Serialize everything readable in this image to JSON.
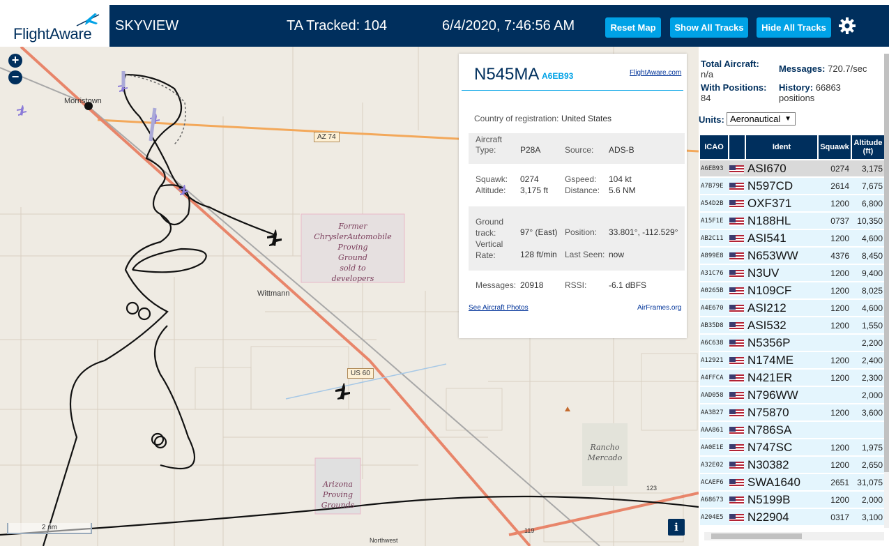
{
  "header": {
    "logo": "FlightAware",
    "app_title": "SKYVIEW",
    "ta_tracked": "TA Tracked: 104",
    "datetime": "6/4/2020, 7:46:56 AM",
    "buttons": {
      "reset": "Reset Map",
      "show_all": "Show All Tracks",
      "hide_all": "Hide All Tracks"
    },
    "settings_icon": "gear-icon"
  },
  "map": {
    "zoom_in": "+",
    "zoom_out": "−",
    "scale": "2 nm",
    "places": {
      "morristown": "Morristown",
      "wittmann": "Wittmann"
    },
    "shields": {
      "az74": "AZ 74",
      "us60": "US 60",
      "r123": "123",
      "r119": "119"
    },
    "chrysler": [
      "Former",
      "ChryslerAutomobile",
      "Proving",
      "Ground",
      "sold to",
      "developers"
    ],
    "arizona": [
      "Arizona",
      "Proving",
      "Grounds"
    ],
    "rancho": [
      "Rancho",
      "Mercado"
    ],
    "northwest": "Northwest",
    "info": "i"
  },
  "selected": {
    "callsign": "N545MA",
    "icao": "A6EB93",
    "fa_link": "FlightAware.com",
    "country_label": "Country of registration:",
    "country": "United States",
    "type_label": "Aircraft Type:",
    "type": "P28A",
    "source_label": "Source:",
    "source": "ADS-B",
    "squawk_label": "Squawk:",
    "squawk": "0274",
    "gspeed_label": "Gspeed:",
    "gspeed": "104 kt",
    "altitude_label": "Altitude:",
    "altitude": "3,175 ft",
    "distance_label": "Distance:",
    "distance": "5.6 NM",
    "track_label": "Ground track:",
    "track": "97° (East)",
    "position_label": "Position:",
    "position": "33.801°, -112.529°",
    "vrate_label": "Vertical Rate:",
    "vrate": "128 ft/min",
    "lastseen_label": "Last Seen:",
    "lastseen": "now",
    "messages_label": "Messages:",
    "messages": "20918",
    "rssi_label": "RSSI:",
    "rssi": "-6.1 dBFS",
    "photos_link": "See Aircraft Photos",
    "airframes_link": "AirFrames.org"
  },
  "sidebar": {
    "total_label": "Total Aircraft:",
    "total": "n/a",
    "messages_label": "Messages:",
    "messages": "720.7/sec",
    "withpos_label": "With Positions:",
    "withpos": "84",
    "history_label": "History:",
    "history": "66863 positions",
    "units_label": "Units:",
    "units": "Aeronautical",
    "columns": [
      "ICAO",
      "",
      "Ident",
      "Squawk",
      "Altitude (ft)"
    ],
    "rows": [
      {
        "icao": "A6EB93",
        "ident": "ASI670",
        "squawk": "0274",
        "alt": "3,175",
        "sel": true
      },
      {
        "icao": "A7B79E",
        "ident": "N597CD",
        "squawk": "2614",
        "alt": "7,675"
      },
      {
        "icao": "A54D2B",
        "ident": "OXF371",
        "squawk": "1200",
        "alt": "6,800"
      },
      {
        "icao": "A15F1E",
        "ident": "N188HL",
        "squawk": "0737",
        "alt": "10,350"
      },
      {
        "icao": "AB2C11",
        "ident": "ASI541",
        "squawk": "1200",
        "alt": "4,600"
      },
      {
        "icao": "A899E8",
        "ident": "N653WW",
        "squawk": "4376",
        "alt": "8,450"
      },
      {
        "icao": "A31C76",
        "ident": "N3UV",
        "squawk": "1200",
        "alt": "9,400"
      },
      {
        "icao": "A0265B",
        "ident": "N109CF",
        "squawk": "1200",
        "alt": "8,025"
      },
      {
        "icao": "A4E670",
        "ident": "ASI212",
        "squawk": "1200",
        "alt": "4,600"
      },
      {
        "icao": "AB35D8",
        "ident": "ASI532",
        "squawk": "1200",
        "alt": "1,550"
      },
      {
        "icao": "A6C638",
        "ident": "N5356P",
        "squawk": "",
        "alt": "2,200"
      },
      {
        "icao": "A12921",
        "ident": "N174ME",
        "squawk": "1200",
        "alt": "2,400"
      },
      {
        "icao": "A4FFCA",
        "ident": "N421ER",
        "squawk": "1200",
        "alt": "2,300"
      },
      {
        "icao": "AAD058",
        "ident": "N796WW",
        "squawk": "",
        "alt": "2,000"
      },
      {
        "icao": "AA3B27",
        "ident": "N75870",
        "squawk": "1200",
        "alt": "3,600"
      },
      {
        "icao": "AAA861",
        "ident": "N786SA",
        "squawk": "",
        "alt": ""
      },
      {
        "icao": "AA0E1E",
        "ident": "N747SC",
        "squawk": "1200",
        "alt": "1,975"
      },
      {
        "icao": "A32E02",
        "ident": "N30382",
        "squawk": "1200",
        "alt": "2,650"
      },
      {
        "icao": "ACAEF6",
        "ident": "SWA1640",
        "squawk": "2651",
        "alt": "31,075"
      },
      {
        "icao": "A68673",
        "ident": "N5199B",
        "squawk": "1200",
        "alt": "2,000"
      },
      {
        "icao": "A204E5",
        "ident": "N22904",
        "squawk": "0317",
        "alt": "3,100"
      }
    ]
  }
}
